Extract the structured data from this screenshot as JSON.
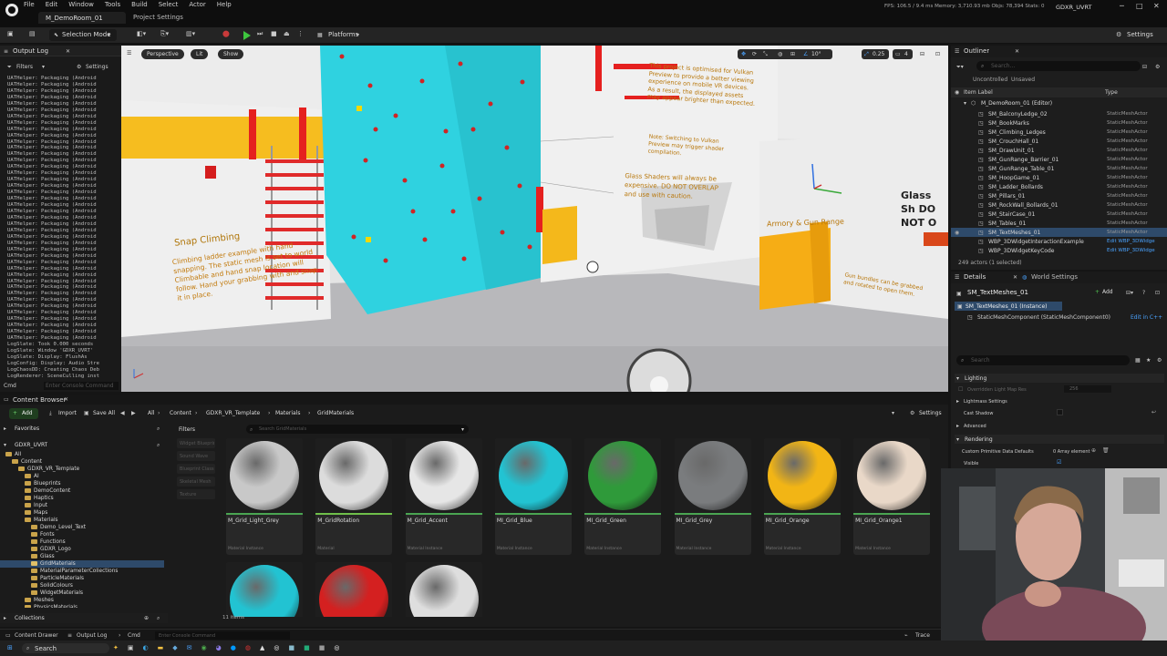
{
  "window": {
    "menu": [
      "File",
      "Edit",
      "Window",
      "Tools",
      "Build",
      "Select",
      "Actor",
      "Help"
    ],
    "tab_map": "M_DemoRoom_01",
    "tab_settings": "Project Settings",
    "stats": "FPS: 106.5 / 9.4 ms   Memory: 3,710.93 mb   Objs: 78,394   Stats: 0",
    "title": "GDXR_UVRT"
  },
  "toolbar": {
    "selection_mode": "Selection Mode",
    "platforms": "Platforms",
    "settings": "Settings"
  },
  "output_log": {
    "tab": "Output Log",
    "filters": "Filters",
    "settings": "Settings",
    "lines": "UATHelper: Packaging (Android\nUATHelper: Packaging (Android\nUATHelper: Packaging (Android\nUATHelper: Packaging (Android\nUATHelper: Packaging (Android\nUATHelper: Packaging (Android\nUATHelper: Packaging (Android\nUATHelper: Packaging (Android\nUATHelper: Packaging (Android\nUATHelper: Packaging (Android\nUATHelper: Packaging (Android\nUATHelper: Packaging (Android\nUATHelper: Packaging (Android\nUATHelper: Packaging (Android\nUATHelper: Packaging (Android\nUATHelper: Packaging (Android\nUATHelper: Packaging (Android\nUATHelper: Packaging (Android\nUATHelper: Packaging (Android\nUATHelper: Packaging (Android\nUATHelper: Packaging (Android\nUATHelper: Packaging (Android\nUATHelper: Packaging (Android\nUATHelper: Packaging (Android\nUATHelper: Packaging (Android\nUATHelper: Packaging (Android\nUATHelper: Packaging (Android\nUATHelper: Packaging (Android\nUATHelper: Packaging (Android\nUATHelper: Packaging (Android\nUATHelper: Packaging (Android\nUATHelper: Packaging (Android\nUATHelper: Packaging (Android\nUATHelper: Packaging (Android\nUATHelper: Packaging (Android\nUATHelper: Packaging (Android\nUATHelper: Packaging (Android\nUATHelper: Packaging (Android\nUATHelper: Packaging (Android\nUATHelper: Packaging (Android\nUATHelper: Packaging (Android\nUATHelper: Packaging (Android\nLogSlate: Took 0.000 seconds\nLogSlate: Window 'GDXR_UVRT'\nLogSlate: Display: FlushAs\nLogConfig: Display: Audio Stre\nLogChaosDD: Creating Chaos Deb\nLogRenderer: SceneCulling inst",
    "cmd": "Cmd",
    "cmd_placeholder": "Enter Console Command"
  },
  "viewport": {
    "perspective": "Perspective",
    "lit": "Lit",
    "show": "Show",
    "snap_angle": "10°",
    "snap_scale": "0.25",
    "camera_speed": "4",
    "signs": {
      "snap_title": "Snap Climbing",
      "snap_body": "Climbing ladder example with hand snapping. The static mesh is set to world Climbable and hand snap location will follow. Hand your grabbing with and snap it in place.",
      "optimized": "This project is optimised for Vulkan Preview to provide a better viewing experience on mobile VR devices. As a result, the displayed assets may appear brighter than expected.",
      "vulkan_note": "Note: Switching to Vulkan Preview may trigger shader compilation.",
      "shaders": "Glass Shaders will always be expensive. DO NOT OVERLAP and use with caution.",
      "glass": "Glass Sh DO NOT O",
      "armory": "Armory & Gun Range",
      "bundles": "Gun bundles can be grabbed and rotated to open them."
    }
  },
  "outliner": {
    "tab": "Outliner",
    "search_placeholder": "Search...",
    "uncontrolled": "Uncontrolled",
    "unsaved": "Unsaved",
    "col_label": "Item Label",
    "col_type": "Type",
    "root": "M_DemoRoom_01 (Editor)",
    "rows": [
      {
        "name": "SM_BalconyLedge_02",
        "type": "StaticMeshActor"
      },
      {
        "name": "SM_BookMarks",
        "type": "StaticMeshActor"
      },
      {
        "name": "SM_Climbing_Ledges",
        "type": "StaticMeshActor"
      },
      {
        "name": "SM_CrouchHall_01",
        "type": "StaticMeshActor"
      },
      {
        "name": "SM_DrawUnit_01",
        "type": "StaticMeshActor"
      },
      {
        "name": "SM_GunRange_Barrier_01",
        "type": "StaticMeshActor"
      },
      {
        "name": "SM_GunRange_Table_01",
        "type": "StaticMeshActor"
      },
      {
        "name": "SM_HoopGame_01",
        "type": "StaticMeshActor"
      },
      {
        "name": "SM_Ladder_Bollards",
        "type": "StaticMeshActor"
      },
      {
        "name": "SM_Pillars_01",
        "type": "StaticMeshActor"
      },
      {
        "name": "SM_RockWall_Bollards_01",
        "type": "StaticMeshActor"
      },
      {
        "name": "SM_StairCase_01",
        "type": "StaticMeshActor"
      },
      {
        "name": "SM_Tables_01",
        "type": "StaticMeshActor"
      },
      {
        "name": "SM_TextMeshes_01",
        "type": "StaticMeshActor"
      },
      {
        "name": "WBP_3DWidgetInteractionExample",
        "type": "Edit WBP_3DWidge"
      },
      {
        "name": "WBP_3DWidgetKeyCode",
        "type": "Edit WBP_3DWidge"
      }
    ],
    "selected_index": 13,
    "count": "249 actors (1 selected)"
  },
  "details": {
    "tab": "Details",
    "world_tab": "World Settings",
    "actor_name": "SM_TextMeshes_01",
    "add": "Add",
    "instance": "SM_TextMeshes_01 (Instance)",
    "component": "StaticMeshComponent (StaticMeshComponent0)",
    "edit_cpp": "Edit in C++",
    "search_placeholder": "Search",
    "section_lighting": "Lighting",
    "prop_override": "Overridden Light Map Res",
    "prop_override_val": "256",
    "prop_lightmass": "Lightmass Settings",
    "prop_cast_shadow": "Cast Shadow",
    "prop_advanced": "Advanced",
    "section_rendering": "Rendering",
    "prop_custom": "Custom Primitive Data Defaults",
    "prop_custom_val": "0 Array element",
    "prop_visible": "Visible"
  },
  "content_browser": {
    "tab": "Content Browser",
    "add": "Add",
    "import": "Import",
    "save_all": "Save All",
    "breadcrumb": [
      "All",
      "Content",
      "GDXR_VR_Template",
      "Materials",
      "GridMaterials"
    ],
    "settings": "Settings",
    "favorites": "Favorites",
    "project": "GDXR_UVRT",
    "tree": [
      {
        "label": "All",
        "depth": 0
      },
      {
        "label": "Content",
        "depth": 1
      },
      {
        "label": "GDXR_VR_Template",
        "depth": 2
      },
      {
        "label": "AI",
        "depth": 3
      },
      {
        "label": "Blueprints",
        "depth": 3
      },
      {
        "label": "DemoContent",
        "depth": 3
      },
      {
        "label": "Haptics",
        "depth": 3
      },
      {
        "label": "Input",
        "depth": 3
      },
      {
        "label": "Maps",
        "depth": 3
      },
      {
        "label": "Materials",
        "depth": 3
      },
      {
        "label": "Demo_Level_Text",
        "depth": 4
      },
      {
        "label": "Fonts",
        "depth": 4
      },
      {
        "label": "Functions",
        "depth": 4
      },
      {
        "label": "GDXR_Logo",
        "depth": 4
      },
      {
        "label": "Glass",
        "depth": 4
      },
      {
        "label": "GridMaterials",
        "depth": 4
      },
      {
        "label": "MaterialParameterCollections",
        "depth": 4
      },
      {
        "label": "ParticleMaterials",
        "depth": 4
      },
      {
        "label": "SolidColours",
        "depth": 4
      },
      {
        "label": "WidgetMaterials",
        "depth": 4
      },
      {
        "label": "Meshes",
        "depth": 3
      },
      {
        "label": "PhysicsMaterials",
        "depth": 3
      }
    ],
    "filters_label": "Filters",
    "filter_chips": [
      "Widget Blueprint",
      "Sound Wave",
      "Blueprint Class",
      "Skeletal Mesh",
      "Texture"
    ],
    "search_placeholder": "Search GridMaterials",
    "assets": [
      {
        "name": "M_Grid_Light_Grey",
        "kind": "Material Instance",
        "color": "#c8c8c8",
        "bar": "#4aa552"
      },
      {
        "name": "M_GridRotation",
        "kind": "Material",
        "color": "#dcdcdc",
        "bar": "#6fbf4a"
      },
      {
        "name": "M_Grid_Accent",
        "kind": "Material Instance",
        "color": "#e6e6e6",
        "bar": "#4aa552"
      },
      {
        "name": "MI_Grid_Blue",
        "kind": "Material Instance",
        "color": "#22c3d2",
        "bar": "#4aa552"
      },
      {
        "name": "MI_Grid_Green",
        "kind": "Material Instance",
        "color": "#2f9a3a",
        "bar": "#4aa552"
      },
      {
        "name": "MI_Grid_Grey",
        "kind": "Material Instance",
        "color": "#7a7c7e",
        "bar": "#4aa552"
      },
      {
        "name": "MI_Grid_Orange",
        "kind": "Material Instance",
        "color": "#f2b515",
        "bar": "#4aa552"
      },
      {
        "name": "MI_Grid_Orange1",
        "kind": "Material Instance",
        "color": "#e9d8c8",
        "bar": "#4aa552"
      },
      {
        "name": "",
        "kind": "",
        "color": "#22c3d2",
        "bar": "#4aa552"
      },
      {
        "name": "",
        "kind": "",
        "color": "#d42020",
        "bar": "#4aa552"
      },
      {
        "name": "",
        "kind": "",
        "color": "#dedede",
        "bar": "#4aa552"
      }
    ],
    "count": "11 items",
    "collections": "Collections"
  },
  "statusbar": {
    "content_drawer": "Content Drawer",
    "output_log": "Output Log",
    "cmd": "Cmd",
    "cmd_placeholder": "Enter Console Command",
    "trace": "Trace"
  },
  "taskbar": {
    "search": "Search"
  }
}
